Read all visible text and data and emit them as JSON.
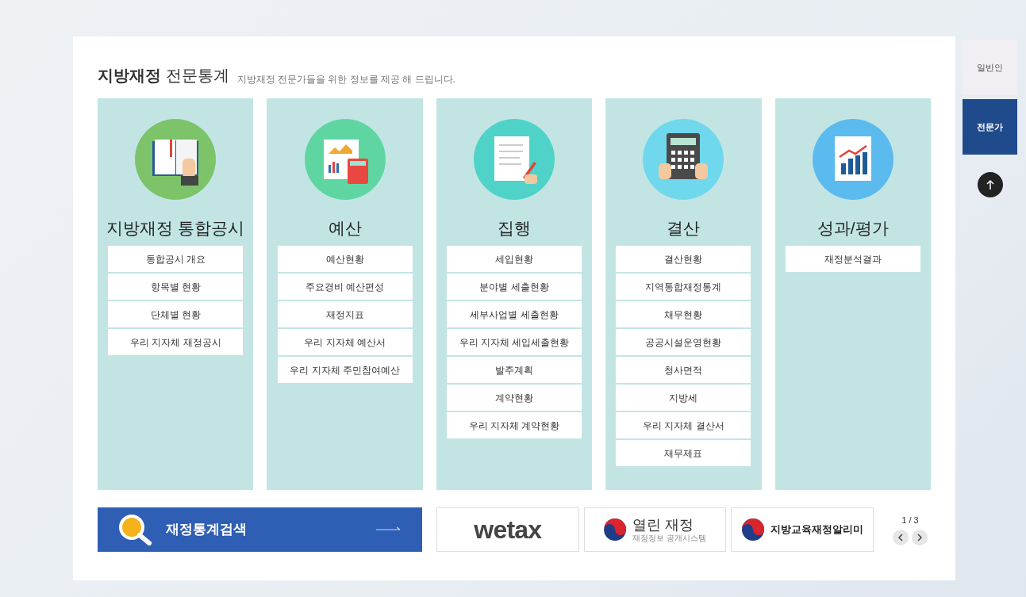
{
  "header": {
    "title": "**지방재정** 전문통계",
    "subtitle": "지방재정 전문가들을 위한 정보를 제공 해 드립니다."
  },
  "categories": [
    {
      "kind": "book",
      "color": "#7cc36a",
      "title": "지방재정 통합공시",
      "items": [
        "통합공시 개요",
        "항목별 현황",
        "단체별 현황",
        "우리 지자체 재정공시"
      ]
    },
    {
      "kind": "budget",
      "color": "#5fd6a2",
      "title": "예산",
      "items": [
        "예산현황",
        "주요경비 예산편성",
        "재정지표",
        "우리 지자체 예산서",
        "우리 지자체 주민참여예산"
      ]
    },
    {
      "kind": "document",
      "color": "#4fd3c8",
      "title": "집행",
      "items": [
        "세입현황",
        "분야별 세출현황",
        "세부사업별 세출현황",
        "우리 지자체 세입세출현황",
        "발주계획",
        "계약현황",
        "우리 지자체 계약현황"
      ]
    },
    {
      "kind": "calculator",
      "color": "#6fd8ec",
      "title": "결산",
      "items": [
        "결산현황",
        "지역통합재정통계",
        "채무현황",
        "공공시설운영현황",
        "청사면적",
        "지방세",
        "우리 지자체 결산서",
        "재무제표"
      ]
    },
    {
      "kind": "chart",
      "color": "#5bbbef",
      "title": "성과/평가",
      "items": [
        "재정분석결과"
      ]
    }
  ],
  "search_banner": {
    "label": "재정통계검색"
  },
  "links": [
    {
      "kind": "wetax",
      "label": "wetax"
    },
    {
      "kind": "open",
      "label": "열린 재정",
      "sublabel": "재정정보 공개시스템"
    },
    {
      "kind": "edu",
      "label": "지방교육재정알리미"
    }
  ],
  "pager": {
    "text": "1 / 3"
  },
  "side_tabs": [
    {
      "label": "일반인",
      "selected": false
    },
    {
      "label": "전문가",
      "selected": true
    }
  ]
}
